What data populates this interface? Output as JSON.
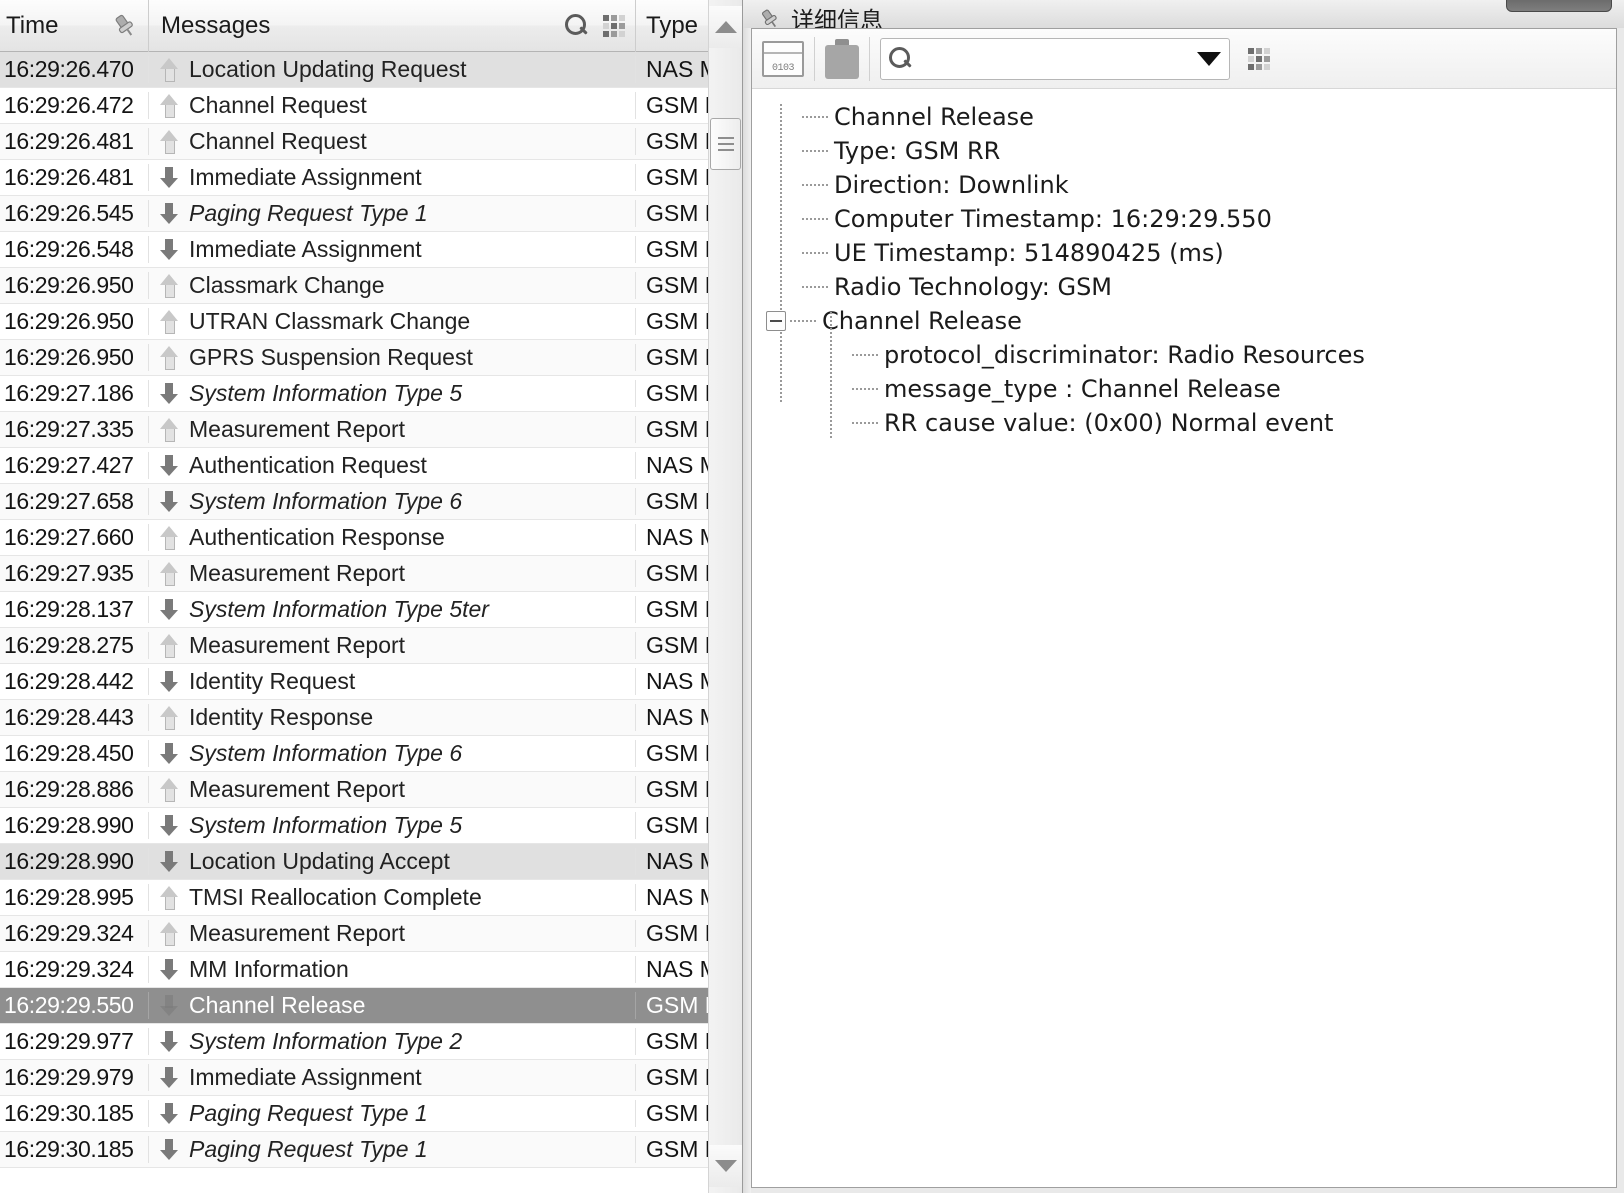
{
  "message_list": {
    "columns": [
      {
        "key": "time",
        "label": "Time"
      },
      {
        "key": "messages",
        "label": "Messages"
      },
      {
        "key": "type",
        "label": "Type"
      }
    ],
    "header_icons": {
      "pin": "pin-icon",
      "search": "search-icon",
      "grid": "grid-icon"
    },
    "rows": [
      {
        "time": "16:29:26.470",
        "dir": "ul",
        "message": "Location Updating Request",
        "type": "NAS MM",
        "italic": false,
        "state": "soft"
      },
      {
        "time": "16:29:26.472",
        "dir": "ul",
        "message": "Channel Request",
        "type": "GSM RR",
        "italic": false,
        "state": "normal"
      },
      {
        "time": "16:29:26.481",
        "dir": "ul",
        "message": "Channel Request",
        "type": "GSM RR",
        "italic": false,
        "state": "alt"
      },
      {
        "time": "16:29:26.481",
        "dir": "dl",
        "message": "Immediate Assignment",
        "type": "GSM RR",
        "italic": false,
        "state": "normal"
      },
      {
        "time": "16:29:26.545",
        "dir": "dl",
        "message": "Paging Request Type 1",
        "type": "GSM RR",
        "italic": true,
        "state": "alt"
      },
      {
        "time": "16:29:26.548",
        "dir": "dl",
        "message": "Immediate Assignment",
        "type": "GSM RR",
        "italic": false,
        "state": "normal"
      },
      {
        "time": "16:29:26.950",
        "dir": "ul",
        "message": "Classmark Change",
        "type": "GSM RR",
        "italic": false,
        "state": "alt"
      },
      {
        "time": "16:29:26.950",
        "dir": "ul",
        "message": "UTRAN Classmark Change",
        "type": "GSM RR",
        "italic": false,
        "state": "normal"
      },
      {
        "time": "16:29:26.950",
        "dir": "ul",
        "message": "GPRS Suspension Request",
        "type": "GSM RR",
        "italic": false,
        "state": "alt"
      },
      {
        "time": "16:29:27.186",
        "dir": "dl",
        "message": "System Information Type 5",
        "type": "GSM RR",
        "italic": true,
        "state": "normal"
      },
      {
        "time": "16:29:27.335",
        "dir": "ul",
        "message": "Measurement Report",
        "type": "GSM RR",
        "italic": false,
        "state": "alt"
      },
      {
        "time": "16:29:27.427",
        "dir": "dl",
        "message": "Authentication Request",
        "type": "NAS MM",
        "italic": false,
        "state": "normal"
      },
      {
        "time": "16:29:27.658",
        "dir": "dl",
        "message": "System Information Type 6",
        "type": "GSM RR",
        "italic": true,
        "state": "alt"
      },
      {
        "time": "16:29:27.660",
        "dir": "ul",
        "message": "Authentication Response",
        "type": "NAS MM",
        "italic": false,
        "state": "normal"
      },
      {
        "time": "16:29:27.935",
        "dir": "ul",
        "message": "Measurement Report",
        "type": "GSM RR",
        "italic": false,
        "state": "alt"
      },
      {
        "time": "16:29:28.137",
        "dir": "dl",
        "message": "System Information Type 5ter",
        "type": "GSM RR",
        "italic": true,
        "state": "normal"
      },
      {
        "time": "16:29:28.275",
        "dir": "ul",
        "message": "Measurement Report",
        "type": "GSM RR",
        "italic": false,
        "state": "alt"
      },
      {
        "time": "16:29:28.442",
        "dir": "dl",
        "message": "Identity Request",
        "type": "NAS MM",
        "italic": false,
        "state": "normal"
      },
      {
        "time": "16:29:28.443",
        "dir": "ul",
        "message": "Identity Response",
        "type": "NAS MM",
        "italic": false,
        "state": "alt"
      },
      {
        "time": "16:29:28.450",
        "dir": "dl",
        "message": "System Information Type 6",
        "type": "GSM RR",
        "italic": true,
        "state": "normal"
      },
      {
        "time": "16:29:28.886",
        "dir": "ul",
        "message": "Measurement Report",
        "type": "GSM RR",
        "italic": false,
        "state": "alt"
      },
      {
        "time": "16:29:28.990",
        "dir": "dl",
        "message": "System Information Type 5",
        "type": "GSM RR",
        "italic": true,
        "state": "normal"
      },
      {
        "time": "16:29:28.990",
        "dir": "dl",
        "message": "Location Updating Accept",
        "type": "NAS MM",
        "italic": false,
        "state": "soft"
      },
      {
        "time": "16:29:28.995",
        "dir": "ul",
        "message": "TMSI Reallocation Complete",
        "type": "NAS MM",
        "italic": false,
        "state": "normal"
      },
      {
        "time": "16:29:29.324",
        "dir": "ul",
        "message": "Measurement Report",
        "type": "GSM RR",
        "italic": false,
        "state": "alt"
      },
      {
        "time": "16:29:29.324",
        "dir": "dl",
        "message": "MM Information",
        "type": "NAS MM",
        "italic": false,
        "state": "normal"
      },
      {
        "time": "16:29:29.550",
        "dir": "dl",
        "message": "Channel Release",
        "type": "GSM RR",
        "italic": false,
        "state": "selected"
      },
      {
        "time": "16:29:29.977",
        "dir": "dl",
        "message": "System Information Type 2",
        "type": "GSM RR",
        "italic": true,
        "state": "normal"
      },
      {
        "time": "16:29:29.979",
        "dir": "dl",
        "message": "Immediate Assignment",
        "type": "GSM RR",
        "italic": false,
        "state": "alt"
      },
      {
        "time": "16:29:30.185",
        "dir": "dl",
        "message": "Paging Request Type 1",
        "type": "GSM RR",
        "italic": true,
        "state": "normal"
      },
      {
        "time": "16:29:30.185",
        "dir": "dl",
        "message": "Paging Request Type 1",
        "type": "GSM RR",
        "italic": true,
        "state": "alt"
      }
    ]
  },
  "details_panel": {
    "title": "详细信息",
    "toolbar": {
      "hex_view_icon": "hex-view-icon",
      "hex_view_label": "0103",
      "clipboard_icon": "clipboard-icon",
      "search_icon": "search-icon",
      "search_value": "",
      "search_placeholder": "",
      "dropdown_icon": "chevron-down-icon",
      "grid_icon": "grid-icon"
    },
    "tree": [
      {
        "level": 0,
        "expander": false,
        "text": "Channel Release"
      },
      {
        "level": 0,
        "expander": false,
        "text": "Type: GSM RR"
      },
      {
        "level": 0,
        "expander": false,
        "text": "Direction: Downlink"
      },
      {
        "level": 0,
        "expander": false,
        "text": "Computer Timestamp: 16:29:29.550"
      },
      {
        "level": 0,
        "expander": false,
        "text": "UE Timestamp: 514890425 (ms)"
      },
      {
        "level": 0,
        "expander": false,
        "text": "Radio Technology: GSM"
      },
      {
        "level": 0,
        "expander": true,
        "text": "Channel Release"
      },
      {
        "level": 1,
        "expander": false,
        "text": "protocol_discriminator: Radio Resources"
      },
      {
        "level": 1,
        "expander": false,
        "text": "message_type : Channel Release"
      },
      {
        "level": 1,
        "expander": false,
        "text": "RR cause value: (0x00) Normal event"
      }
    ]
  },
  "colors": {
    "selection_bg": "#8f8f8f",
    "soft_highlight_bg": "#e0e0e0",
    "header_bg": "#eeeeee",
    "uplink_arrow": "#c8c8c8",
    "downlink_arrow": "#7a7a7a"
  }
}
